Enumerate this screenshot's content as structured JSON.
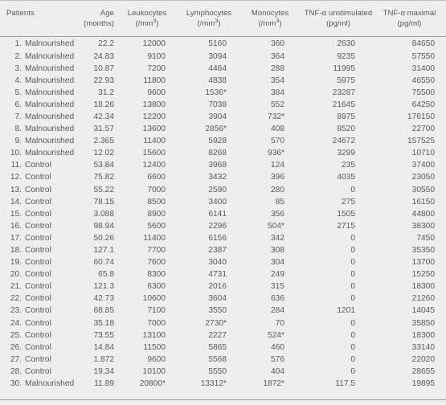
{
  "table": {
    "headers": [
      {
        "line1": "Patients",
        "line2": ""
      },
      {
        "line1": "Age",
        "line2": "(months)"
      },
      {
        "line1": "Leukocytes",
        "line2": "(/mm3)"
      },
      {
        "line1": "Lymphocytes",
        "line2": "(/mm3)"
      },
      {
        "line1": "Monocytes",
        "line2": "(/mm3)"
      },
      {
        "line1": "TNF-α unstimulated",
        "line2": "(pg/ml)"
      },
      {
        "line1": "TNF-α maximal",
        "line2": "(pg/ml)"
      }
    ],
    "rows": [
      {
        "index": "1.",
        "group": "Malnourished",
        "age": "22.2",
        "leukocytes": "12000",
        "leukocytes_star": "",
        "lymphocytes": "5160",
        "lymphocytes_star": "",
        "monocytes": "360",
        "monocytes_star": "",
        "tnf_unstimulated": "2630",
        "tnf_maximal": "84650"
      },
      {
        "index": "2.",
        "group": "Malnourished",
        "age": "24.83",
        "leukocytes": "9100",
        "leukocytes_star": "",
        "lymphocytes": "3094",
        "lymphocytes_star": "",
        "monocytes": "364",
        "monocytes_star": "",
        "tnf_unstimulated": "9235",
        "tnf_maximal": "57550"
      },
      {
        "index": "3.",
        "group": "Malnourished",
        "age": "10.87",
        "leukocytes": "7200",
        "leukocytes_star": "",
        "lymphocytes": "4464",
        "lymphocytes_star": "",
        "monocytes": "288",
        "monocytes_star": "",
        "tnf_unstimulated": "11995",
        "tnf_maximal": "31400"
      },
      {
        "index": "4.",
        "group": "Malnourished",
        "age": "22.93",
        "leukocytes": "11800",
        "leukocytes_star": "",
        "lymphocytes": "4838",
        "lymphocytes_star": "",
        "monocytes": "354",
        "monocytes_star": "",
        "tnf_unstimulated": "5975",
        "tnf_maximal": "46550"
      },
      {
        "index": "5.",
        "group": "Malnourished",
        "age": "31.2",
        "leukocytes": "9600",
        "leukocytes_star": "",
        "lymphocytes": "1536",
        "lymphocytes_star": "*",
        "monocytes": "384",
        "monocytes_star": "",
        "tnf_unstimulated": "23287",
        "tnf_maximal": "75500"
      },
      {
        "index": "6.",
        "group": "Malnourished",
        "age": "18.26",
        "leukocytes": "13800",
        "leukocytes_star": "",
        "lymphocytes": "7038",
        "lymphocytes_star": "",
        "monocytes": "552",
        "monocytes_star": "",
        "tnf_unstimulated": "21645",
        "tnf_maximal": "64250"
      },
      {
        "index": "7.",
        "group": "Malnourished",
        "age": "42.34",
        "leukocytes": "12200",
        "leukocytes_star": "",
        "lymphocytes": "3904",
        "lymphocytes_star": "",
        "monocytes": "732",
        "monocytes_star": "*",
        "tnf_unstimulated": "8975",
        "tnf_maximal": "176150"
      },
      {
        "index": "8.",
        "group": "Malnourished",
        "age": "31.57",
        "leukocytes": "13600",
        "leukocytes_star": "",
        "lymphocytes": "2856",
        "lymphocytes_star": "*",
        "monocytes": "408",
        "monocytes_star": "",
        "tnf_unstimulated": "8520",
        "tnf_maximal": "22700"
      },
      {
        "index": "9.",
        "group": "Malnourished",
        "age": "2.365",
        "leukocytes": "11400",
        "leukocytes_star": "",
        "lymphocytes": "5928",
        "lymphocytes_star": "",
        "monocytes": "570",
        "monocytes_star": "",
        "tnf_unstimulated": "24672",
        "tnf_maximal": "157525"
      },
      {
        "index": "10.",
        "group": "Malnourished",
        "age": "12.02",
        "leukocytes": "15600",
        "leukocytes_star": "",
        "lymphocytes": "8268",
        "lymphocytes_star": "",
        "monocytes": "936",
        "monocytes_star": "*",
        "tnf_unstimulated": "3299",
        "tnf_maximal": "10710"
      },
      {
        "index": "11.",
        "group": "Control",
        "age": "53.84",
        "leukocytes": "12400",
        "leukocytes_star": "",
        "lymphocytes": "3968",
        "lymphocytes_star": "",
        "monocytes": "124",
        "monocytes_star": "",
        "tnf_unstimulated": "235",
        "tnf_maximal": "37400"
      },
      {
        "index": "12.",
        "group": "Control",
        "age": "75.82",
        "leukocytes": "6600",
        "leukocytes_star": "",
        "lymphocytes": "3432",
        "lymphocytes_star": "",
        "monocytes": "396",
        "monocytes_star": "",
        "tnf_unstimulated": "4035",
        "tnf_maximal": "23050"
      },
      {
        "index": "13.",
        "group": "Control",
        "age": "55.22",
        "leukocytes": "7000",
        "leukocytes_star": "",
        "lymphocytes": "2590",
        "lymphocytes_star": "",
        "monocytes": "280",
        "monocytes_star": "",
        "tnf_unstimulated": "0",
        "tnf_maximal": "30550"
      },
      {
        "index": "14.",
        "group": "Control",
        "age": "78.15",
        "leukocytes": "8500",
        "leukocytes_star": "",
        "lymphocytes": "3400",
        "lymphocytes_star": "",
        "monocytes": "85",
        "monocytes_star": "",
        "tnf_unstimulated": "275",
        "tnf_maximal": "16150"
      },
      {
        "index": "15.",
        "group": "Control",
        "age": "3.088",
        "leukocytes": "8900",
        "leukocytes_star": "",
        "lymphocytes": "6141",
        "lymphocytes_star": "",
        "monocytes": "356",
        "monocytes_star": "",
        "tnf_unstimulated": "1505",
        "tnf_maximal": "44800"
      },
      {
        "index": "16.",
        "group": "Control",
        "age": "98.94",
        "leukocytes": "5600",
        "leukocytes_star": "",
        "lymphocytes": "2296",
        "lymphocytes_star": "",
        "monocytes": "504",
        "monocytes_star": "*",
        "tnf_unstimulated": "2715",
        "tnf_maximal": "38300"
      },
      {
        "index": "17.",
        "group": "Control",
        "age": "50.26",
        "leukocytes": "11400",
        "leukocytes_star": "",
        "lymphocytes": "6156",
        "lymphocytes_star": "",
        "monocytes": "342",
        "monocytes_star": "",
        "tnf_unstimulated": "0",
        "tnf_maximal": "7450"
      },
      {
        "index": "18.",
        "group": "Control",
        "age": "127.1",
        "leukocytes": "7700",
        "leukocytes_star": "",
        "lymphocytes": "2387",
        "lymphocytes_star": "",
        "monocytes": "308",
        "monocytes_star": "",
        "tnf_unstimulated": "0",
        "tnf_maximal": "35350"
      },
      {
        "index": "19.",
        "group": "Control",
        "age": "60.74",
        "leukocytes": "7600",
        "leukocytes_star": "",
        "lymphocytes": "3040",
        "lymphocytes_star": "",
        "monocytes": "304",
        "monocytes_star": "",
        "tnf_unstimulated": "0",
        "tnf_maximal": "13700"
      },
      {
        "index": "20.",
        "group": "Control",
        "age": "65.8",
        "leukocytes": "8300",
        "leukocytes_star": "",
        "lymphocytes": "4731",
        "lymphocytes_star": "",
        "monocytes": "249",
        "monocytes_star": "",
        "tnf_unstimulated": "0",
        "tnf_maximal": "15250"
      },
      {
        "index": "21.",
        "group": "Control",
        "age": "121.3",
        "leukocytes": "6300",
        "leukocytes_star": "",
        "lymphocytes": "2016",
        "lymphocytes_star": "",
        "monocytes": "315",
        "monocytes_star": "",
        "tnf_unstimulated": "0",
        "tnf_maximal": "18300"
      },
      {
        "index": "22.",
        "group": "Control",
        "age": "42.73",
        "leukocytes": "10600",
        "leukocytes_star": "",
        "lymphocytes": "3604",
        "lymphocytes_star": "",
        "monocytes": "636",
        "monocytes_star": "",
        "tnf_unstimulated": "0",
        "tnf_maximal": "21260"
      },
      {
        "index": "23.",
        "group": "Control",
        "age": "68.85",
        "leukocytes": "7100",
        "leukocytes_star": "",
        "lymphocytes": "3550",
        "lymphocytes_star": "",
        "monocytes": "284",
        "monocytes_star": "",
        "tnf_unstimulated": "1201",
        "tnf_maximal": "14045"
      },
      {
        "index": "24.",
        "group": "Control",
        "age": "35.18",
        "leukocytes": "7000",
        "leukocytes_star": "",
        "lymphocytes": "2730",
        "lymphocytes_star": "*",
        "monocytes": "70",
        "monocytes_star": "",
        "tnf_unstimulated": "0",
        "tnf_maximal": "35850"
      },
      {
        "index": "25.",
        "group": "Control",
        "age": "73.55",
        "leukocytes": "13100",
        "leukocytes_star": "",
        "lymphocytes": "2227",
        "lymphocytes_star": "",
        "monocytes": "524",
        "monocytes_star": "*",
        "tnf_unstimulated": "0",
        "tnf_maximal": "18300"
      },
      {
        "index": "26.",
        "group": "Control",
        "age": "14.84",
        "leukocytes": "11500",
        "leukocytes_star": "",
        "lymphocytes": "5865",
        "lymphocytes_star": "",
        "monocytes": "460",
        "monocytes_star": "",
        "tnf_unstimulated": "0",
        "tnf_maximal": "33140"
      },
      {
        "index": "27.",
        "group": "Control",
        "age": "1.872",
        "leukocytes": "9600",
        "leukocytes_star": "",
        "lymphocytes": "5568",
        "lymphocytes_star": "",
        "monocytes": "576",
        "monocytes_star": "",
        "tnf_unstimulated": "0",
        "tnf_maximal": "22020"
      },
      {
        "index": "28.",
        "group": "Control",
        "age": "19.34",
        "leukocytes": "10100",
        "leukocytes_star": "",
        "lymphocytes": "5550",
        "lymphocytes_star": "",
        "monocytes": "404",
        "monocytes_star": "",
        "tnf_unstimulated": "0",
        "tnf_maximal": "28655"
      },
      {
        "index": "30.",
        "group": "Malnourished",
        "age": "11.89",
        "leukocytes": "20800",
        "leukocytes_star": "*",
        "lymphocytes": "13312",
        "lymphocytes_star": "*",
        "monocytes": "1872",
        "monocytes_star": "*",
        "tnf_unstimulated": "117.5",
        "tnf_maximal": "19895"
      }
    ]
  }
}
